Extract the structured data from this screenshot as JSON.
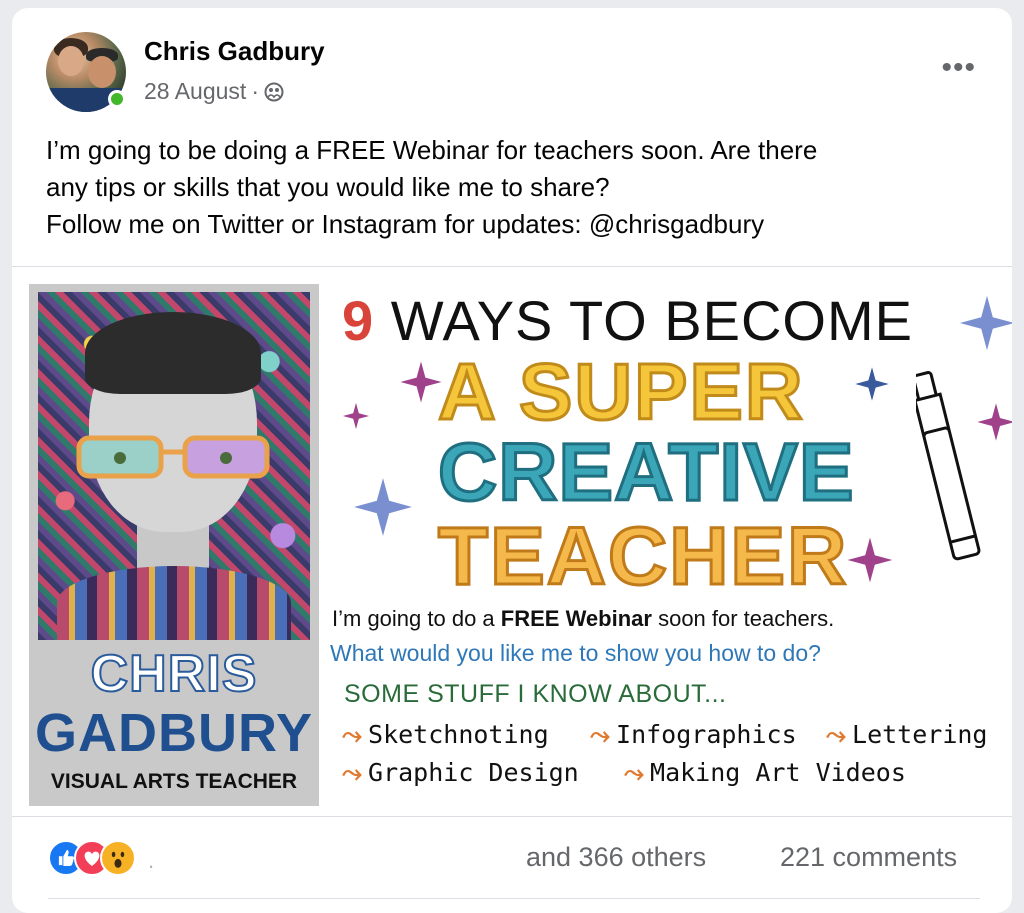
{
  "post": {
    "author": "Chris Gadbury",
    "date": "28 August",
    "separator": "·",
    "privacy_icon": "friends-globe-icon",
    "more_icon": "more-options-icon",
    "text_lines": [
      "I’m going to be doing a FREE Webinar for teachers soon. Are there",
      "any tips or skills that you would like me to share?",
      "Follow me on Twitter or Instagram for updates: @chrisgadbury"
    ]
  },
  "image": {
    "portrait": {
      "name_line1": "CHRIS",
      "name_line2": "GADBURY",
      "role": "VISUAL ARTS TEACHER"
    },
    "headline": {
      "number": "9",
      "line1": "WAYS TO BECOME",
      "line2": "A SUPER",
      "line3": "CREATIVE",
      "line4": "TEACHER"
    },
    "announcement": {
      "part1": "I’m going to do a ",
      "bold1": "FREE Webinar",
      "part2": " soon for teachers.",
      "question": "What would you like me to show you how to do?",
      "stuff": "SOME STUFF I KNOW ABOUT..."
    },
    "skills": [
      "Sketchnoting",
      "Infographics",
      "Lettering",
      "Graphic Design",
      "Making Art Videos"
    ],
    "arrow_glyph": "⤳",
    "colors": {
      "super": "#f5c53a",
      "creative": "#3aa6b8",
      "teacher": "#f5b84a",
      "nine": "#d9443a",
      "question": "#2f78b8",
      "stars": [
        "#7a8fd0",
        "#a0418c"
      ]
    }
  },
  "footer": {
    "reactions": [
      "like-reaction-icon",
      "love-reaction-icon",
      "wow-reaction-icon"
    ],
    "others": "and 366 others",
    "comments": "221 comments"
  }
}
